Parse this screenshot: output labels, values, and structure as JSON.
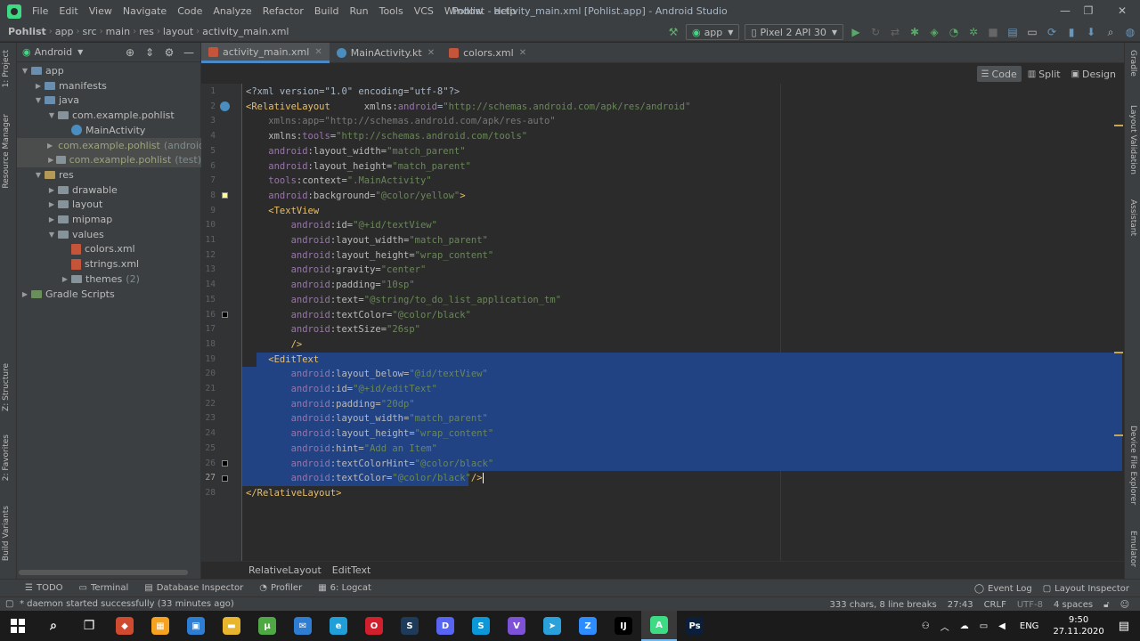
{
  "window": {
    "title": "Pohlist - activity_main.xml [Pohlist.app] - Android Studio",
    "menu": [
      "File",
      "Edit",
      "View",
      "Navigate",
      "Code",
      "Analyze",
      "Refactor",
      "Build",
      "Run",
      "Tools",
      "VCS",
      "Window",
      "Help"
    ]
  },
  "breadcrumbs": [
    "Pohlist",
    "app",
    "src",
    "main",
    "res",
    "layout",
    "activity_main.xml"
  ],
  "toolbar": {
    "run_config": "app",
    "device": "Pixel 2 API 30"
  },
  "project": {
    "view": "Android",
    "tree": [
      {
        "label": "app",
        "level": 0,
        "kind": "folder-blue",
        "expanded": true
      },
      {
        "label": "manifests",
        "level": 1,
        "kind": "folder-blue",
        "expanded": false
      },
      {
        "label": "java",
        "level": 1,
        "kind": "folder-blue",
        "expanded": true
      },
      {
        "label": "com.example.pohlist",
        "level": 2,
        "kind": "folder",
        "expanded": true
      },
      {
        "label": "MainActivity",
        "level": 3,
        "kind": "kotlin"
      },
      {
        "label": "com.example.pohlist",
        "suffix": "(androidTe",
        "level": 2,
        "kind": "folder",
        "expanded": false,
        "selected": true
      },
      {
        "label": "com.example.pohlist",
        "suffix": "(test)",
        "level": 2,
        "kind": "folder",
        "expanded": false,
        "selected": true
      },
      {
        "label": "res",
        "level": 1,
        "kind": "folder-res",
        "expanded": true
      },
      {
        "label": "drawable",
        "level": 2,
        "kind": "folder",
        "expanded": false
      },
      {
        "label": "layout",
        "level": 2,
        "kind": "folder",
        "expanded": false
      },
      {
        "label": "mipmap",
        "level": 2,
        "kind": "folder",
        "expanded": false
      },
      {
        "label": "values",
        "level": 2,
        "kind": "folder",
        "expanded": true
      },
      {
        "label": "colors.xml",
        "level": 3,
        "kind": "xml"
      },
      {
        "label": "strings.xml",
        "level": 3,
        "kind": "xml"
      },
      {
        "label": "themes",
        "suffix": "(2)",
        "level": 3,
        "kind": "folder",
        "expanded": false
      },
      {
        "label": "Gradle Scripts",
        "level": 0,
        "kind": "gradle",
        "expanded": false
      }
    ]
  },
  "tabs": [
    {
      "label": "activity_main.xml",
      "active": true,
      "icon": "xml"
    },
    {
      "label": "MainActivity.kt",
      "active": false,
      "icon": "kotlin"
    },
    {
      "label": "colors.xml",
      "active": false,
      "icon": "xml"
    }
  ],
  "modes": [
    "Code",
    "Split",
    "Design"
  ],
  "left_tool_tabs": [
    "1: Project",
    "Resource Manager",
    "Z: Structure",
    "2: Favorites",
    "Build Variants"
  ],
  "right_tool_tabs": [
    "Gradle",
    "Layout Validation",
    "Assistant",
    "Device File Explorer",
    "Emulator"
  ],
  "code_lines": [
    [
      {
        "t": "<?xml version=\"1.0\" encoding=\"utf-8\"?>",
        "c": "plain"
      }
    ],
    [
      {
        "t": "<RelativeLayout",
        "c": "tag"
      },
      {
        "t": "      xmlns:",
        "c": "attr"
      },
      {
        "t": "android",
        "c": "ns"
      },
      {
        "t": "=",
        "c": "plain"
      },
      {
        "t": "\"http://schemas.android.com/apk/res/android\"",
        "c": "str"
      }
    ],
    [
      {
        "t": "    xmlns:app=\"http://schemas.android.com/apk/res-auto\"",
        "c": "dim"
      }
    ],
    [
      {
        "t": "    xmlns:",
        "c": "attr"
      },
      {
        "t": "tools",
        "c": "ns"
      },
      {
        "t": "=",
        "c": "plain"
      },
      {
        "t": "\"http://schemas.android.com/tools\"",
        "c": "str"
      }
    ],
    [
      {
        "t": "    android",
        "c": "ns"
      },
      {
        "t": ":layout_width=",
        "c": "attr"
      },
      {
        "t": "\"match_parent\"",
        "c": "str"
      }
    ],
    [
      {
        "t": "    android",
        "c": "ns"
      },
      {
        "t": ":layout_height=",
        "c": "attr"
      },
      {
        "t": "\"match_parent\"",
        "c": "str"
      }
    ],
    [
      {
        "t": "    tools",
        "c": "ns"
      },
      {
        "t": ":context=",
        "c": "attr"
      },
      {
        "t": "\".MainActivity\"",
        "c": "str"
      }
    ],
    [
      {
        "t": "    android",
        "c": "ns"
      },
      {
        "t": ":background=",
        "c": "attr"
      },
      {
        "t": "\"@color/yellow\"",
        "c": "str"
      },
      {
        "t": ">",
        "c": "tag"
      }
    ],
    [
      {
        "t": "    <TextView",
        "c": "tag"
      }
    ],
    [
      {
        "t": "        android",
        "c": "ns"
      },
      {
        "t": ":id=",
        "c": "attr"
      },
      {
        "t": "\"@+id/textView\"",
        "c": "str"
      }
    ],
    [
      {
        "t": "        android",
        "c": "ns"
      },
      {
        "t": ":layout_width=",
        "c": "attr"
      },
      {
        "t": "\"match_parent\"",
        "c": "str"
      }
    ],
    [
      {
        "t": "        android",
        "c": "ns"
      },
      {
        "t": ":layout_height=",
        "c": "attr"
      },
      {
        "t": "\"wrap_content\"",
        "c": "str"
      }
    ],
    [
      {
        "t": "        android",
        "c": "ns"
      },
      {
        "t": ":gravity=",
        "c": "attr"
      },
      {
        "t": "\"center\"",
        "c": "str"
      }
    ],
    [
      {
        "t": "        android",
        "c": "ns"
      },
      {
        "t": ":padding=",
        "c": "attr"
      },
      {
        "t": "\"10sp\"",
        "c": "str"
      }
    ],
    [
      {
        "t": "        android",
        "c": "ns"
      },
      {
        "t": ":text=",
        "c": "attr"
      },
      {
        "t": "\"@string/to_do_list_application_tm\"",
        "c": "str"
      }
    ],
    [
      {
        "t": "        android",
        "c": "ns"
      },
      {
        "t": ":textColor=",
        "c": "attr"
      },
      {
        "t": "\"@color/black\"",
        "c": "str"
      }
    ],
    [
      {
        "t": "        android",
        "c": "ns"
      },
      {
        "t": ":textSize=",
        "c": "attr"
      },
      {
        "t": "\"26sp\"",
        "c": "str"
      }
    ],
    [
      {
        "t": "        />",
        "c": "tag"
      }
    ],
    [
      {
        "t": "    <EditText",
        "c": "tag"
      }
    ],
    [
      {
        "t": "        android",
        "c": "ns"
      },
      {
        "t": ":layout_below=",
        "c": "attr"
      },
      {
        "t": "\"@id/textView\"",
        "c": "str"
      }
    ],
    [
      {
        "t": "        android",
        "c": "ns"
      },
      {
        "t": ":id=",
        "c": "attr"
      },
      {
        "t": "\"@+id/editText\"",
        "c": "str"
      }
    ],
    [
      {
        "t": "        android",
        "c": "ns"
      },
      {
        "t": ":padding=",
        "c": "attr"
      },
      {
        "t": "\"20dp\"",
        "c": "str"
      }
    ],
    [
      {
        "t": "        android",
        "c": "ns"
      },
      {
        "t": ":layout_width=",
        "c": "attr"
      },
      {
        "t": "\"match_parent\"",
        "c": "str"
      }
    ],
    [
      {
        "t": "        android",
        "c": "ns"
      },
      {
        "t": ":layout_height=",
        "c": "attr"
      },
      {
        "t": "\"wrap_content\"",
        "c": "str"
      }
    ],
    [
      {
        "t": "        android",
        "c": "ns"
      },
      {
        "t": ":hint=",
        "c": "attr"
      },
      {
        "t": "\"Add an Item\"",
        "c": "str"
      }
    ],
    [
      {
        "t": "        android",
        "c": "ns"
      },
      {
        "t": ":textColorHint=",
        "c": "attr"
      },
      {
        "t": "\"@color/black\"",
        "c": "str"
      }
    ],
    [
      {
        "t": "        android",
        "c": "ns"
      },
      {
        "t": ":textColor=",
        "c": "attr"
      },
      {
        "t": "\"@color/black\"",
        "c": "str"
      },
      {
        "t": "/>",
        "c": "tag"
      }
    ],
    [
      {
        "t": "</RelativeLayout>",
        "c": "tag"
      }
    ]
  ],
  "selection": {
    "first_line": 19,
    "last_line": 27,
    "caret_line": 27
  },
  "editor_breadcrumbs": [
    "RelativeLayout",
    "EditText"
  ],
  "bottom_tools": [
    {
      "label": "TODO",
      "icon": "list-icon"
    },
    {
      "label": "Terminal",
      "icon": "terminal-icon"
    },
    {
      "label": "Database Inspector",
      "icon": "database-icon"
    },
    {
      "label": "Profiler",
      "icon": "profiler-icon"
    },
    {
      "label": "6: Logcat",
      "icon": "logcat-icon"
    }
  ],
  "bottom_right_tools": [
    {
      "label": "Event Log",
      "icon": "event-log-icon"
    },
    {
      "label": "Layout Inspector",
      "icon": "layout-inspector-icon"
    }
  ],
  "status": {
    "message": "* daemon started successfully (33 minutes ago)",
    "chars": "333 chars, 8 line breaks",
    "position": "27:43",
    "line_sep": "CRLF",
    "encoding": "UTF-8",
    "indent": "4 spaces"
  },
  "taskbar": {
    "apps": [
      {
        "name": "search",
        "color": "#1b1b1b",
        "glyph": "⌕"
      },
      {
        "name": "task-view",
        "color": "#1b1b1b",
        "glyph": "❐"
      },
      {
        "name": "app-red",
        "color": "#d04a2f",
        "glyph": "◆"
      },
      {
        "name": "app-orange",
        "color": "#f4a21f",
        "glyph": "▦"
      },
      {
        "name": "store",
        "color": "#2d7dd2",
        "glyph": "▣"
      },
      {
        "name": "explorer",
        "color": "#e8b52f",
        "glyph": "▬"
      },
      {
        "name": "torrent",
        "color": "#4fa843",
        "glyph": "µ"
      },
      {
        "name": "mail",
        "color": "#2d7dd2",
        "glyph": "✉"
      },
      {
        "name": "edge",
        "color": "#1f9ed8",
        "glyph": "e"
      },
      {
        "name": "opera",
        "color": "#d0202d",
        "glyph": "O"
      },
      {
        "name": "steam",
        "color": "#1f3b5a",
        "glyph": "S"
      },
      {
        "name": "discord",
        "color": "#5865f2",
        "glyph": "D"
      },
      {
        "name": "skype",
        "color": "#0c98d8",
        "glyph": "S"
      },
      {
        "name": "viber",
        "color": "#7d52d6",
        "glyph": "V"
      },
      {
        "name": "telegram",
        "color": "#2aa1da",
        "glyph": "➤"
      },
      {
        "name": "zoom",
        "color": "#2d8cff",
        "glyph": "Z"
      },
      {
        "name": "jetbrains",
        "color": "#000000",
        "glyph": "IJ"
      },
      {
        "name": "android-studio",
        "color": "#3ddc84",
        "glyph": "A",
        "active": true
      },
      {
        "name": "photoshop",
        "color": "#0c1f3a",
        "glyph": "Ps"
      }
    ],
    "lang": "ENG",
    "time": "9:50",
    "date": "27.11.2020"
  }
}
